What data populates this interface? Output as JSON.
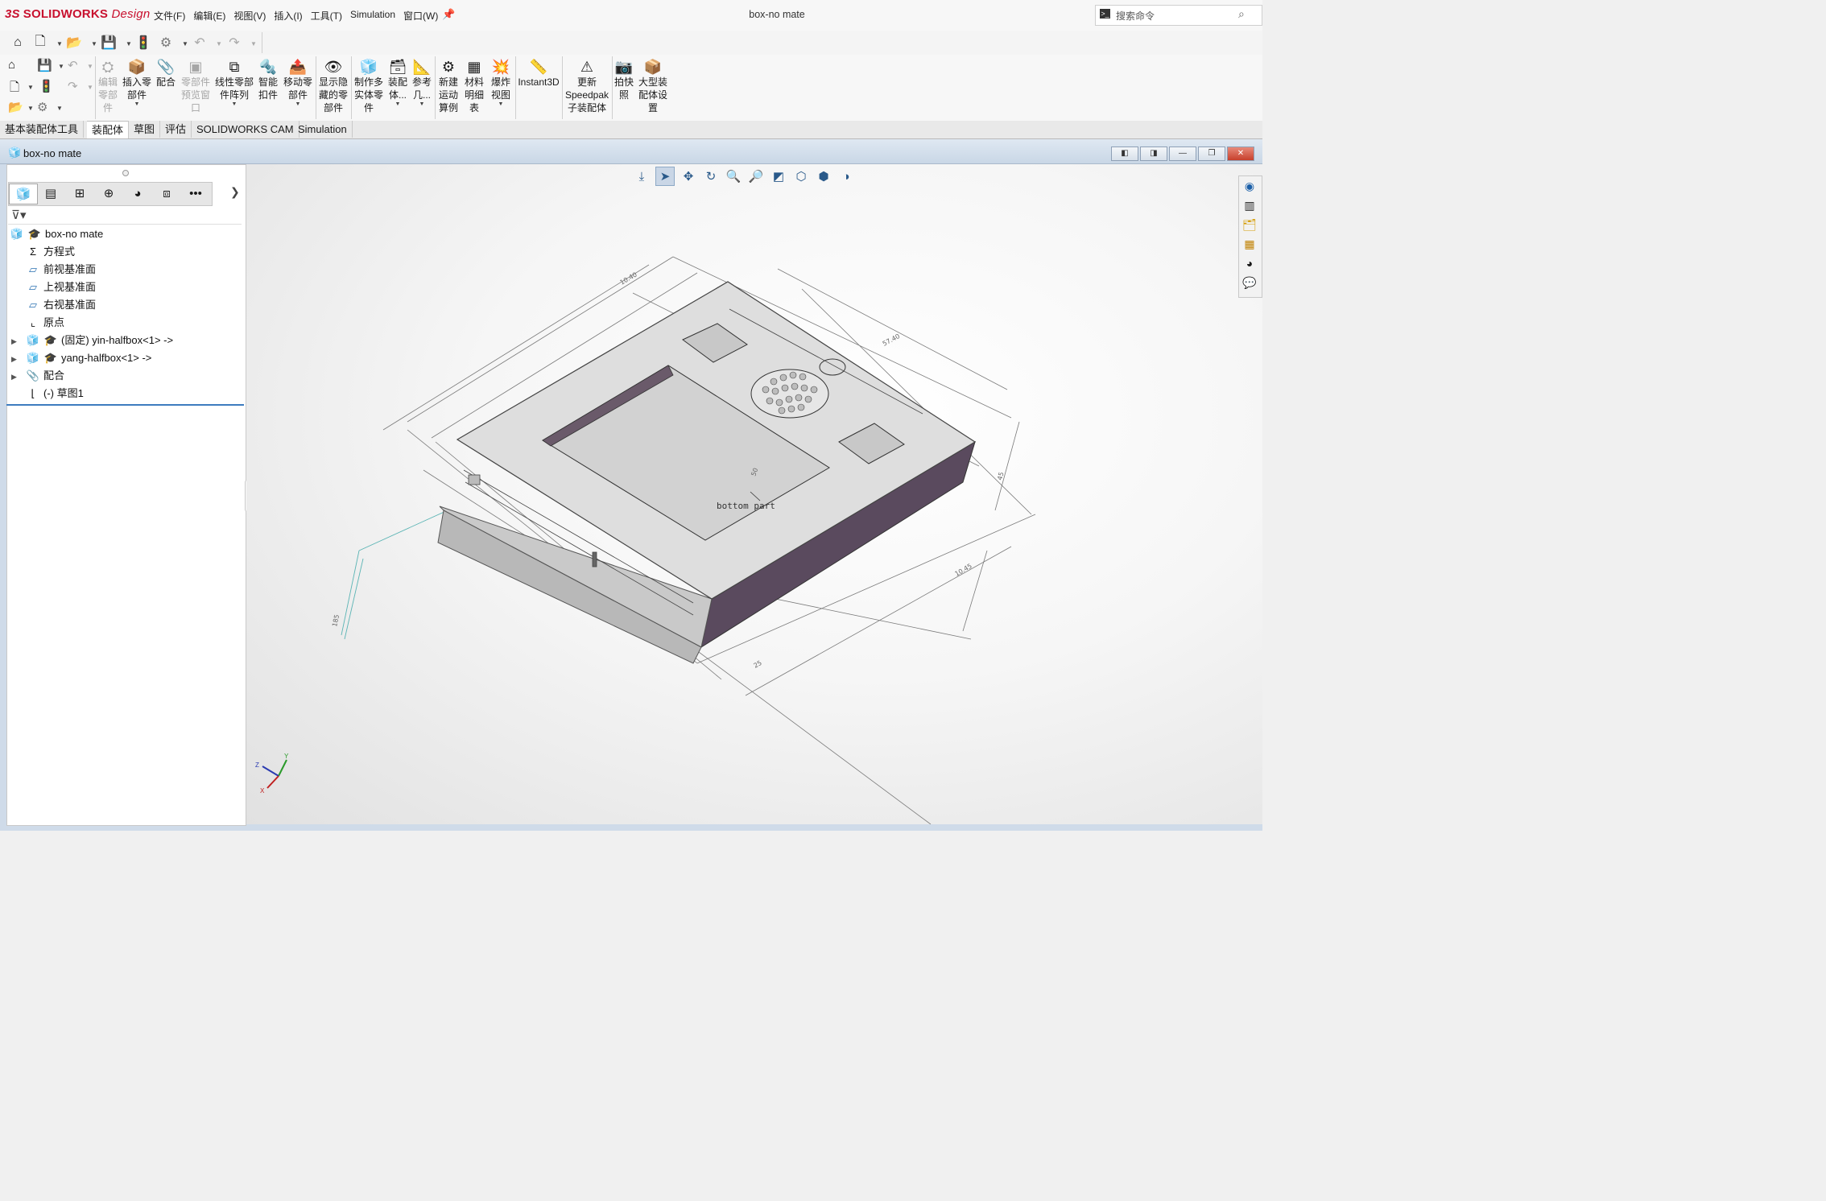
{
  "app": {
    "logo_ds": "3S",
    "logo_brand": "SOLIDWORKS",
    "logo_suffix": "Design",
    "window_title": "box-no mate"
  },
  "menu": [
    "文件(F)",
    "编辑(E)",
    "视图(V)",
    "插入(I)",
    "工具(T)",
    "Simulation",
    "窗口(W)"
  ],
  "search": {
    "placeholder": "搜索命令"
  },
  "commands": {
    "edit_component": [
      "编辑",
      "零部",
      "件"
    ],
    "insert_components": [
      "插入零",
      "部件"
    ],
    "mate": [
      "配合"
    ],
    "component_preview": [
      "零部件",
      "预览窗",
      "口"
    ],
    "linear_pattern": [
      "线性零部",
      "件阵列"
    ],
    "smart_fasteners": [
      "智能",
      "扣件"
    ],
    "move_component": [
      "移动零",
      "部件"
    ],
    "show_hidden": [
      "显示隐",
      "藏的零",
      "部件"
    ],
    "make_multibody": [
      "制作多",
      "实体零",
      "件"
    ],
    "assembly_features": [
      "装配",
      "体..."
    ],
    "reference_geometry": [
      "参考",
      "几..."
    ],
    "new_motion_study": [
      "新建",
      "运动",
      "算例"
    ],
    "bom": [
      "材料",
      "明细",
      "表"
    ],
    "exploded_view": [
      "爆炸",
      "视图"
    ],
    "instant3d": [
      "Instant3D"
    ],
    "update_speedpak": [
      "更新",
      "Speedpak",
      "子装配体"
    ],
    "snapshot": [
      "拍快",
      "照"
    ],
    "large_assembly": [
      "大型装",
      "配体设",
      "置"
    ]
  },
  "tabs": [
    "基本装配体工具",
    "装配体",
    "草图",
    "评估",
    "SOLIDWORKS CAM",
    "Simulation"
  ],
  "active_tab": "装配体",
  "document": {
    "title": "box-no mate"
  },
  "tree": {
    "root": "box-no mate",
    "items": [
      {
        "label": "方程式",
        "icon": "sigma-icon",
        "expandable": false
      },
      {
        "label": "前视基准面",
        "icon": "plane-icon",
        "expandable": false
      },
      {
        "label": "上视基准面",
        "icon": "plane-icon",
        "expandable": false
      },
      {
        "label": "右视基准面",
        "icon": "plane-icon",
        "expandable": false
      },
      {
        "label": "原点",
        "icon": "origin-icon",
        "expandable": false
      },
      {
        "label": "(固定) yin-halfbox<1> ->",
        "icon": "part-icon",
        "expandable": true
      },
      {
        "label": "yang-halfbox<1> ->",
        "icon": "part-icon",
        "expandable": true
      },
      {
        "label": "配合",
        "icon": "mates-icon",
        "expandable": true
      },
      {
        "label": "(-) 草图1",
        "icon": "sketch-icon",
        "expandable": false
      }
    ]
  },
  "viewport": {
    "annotation": "bottom part",
    "dims": [
      "57.40",
      "10.40",
      "10.45",
      "185",
      "50",
      "25",
      "45"
    ],
    "triad": {
      "x": "X",
      "y": "Y",
      "z": "Z"
    }
  },
  "colors": {
    "brand_red": "#c8102e",
    "model_side": "#5a4a5e",
    "model_top": "#dedede",
    "doc_titlebar": "#cfdbe9",
    "tree_accent": "#3d7bbf"
  }
}
